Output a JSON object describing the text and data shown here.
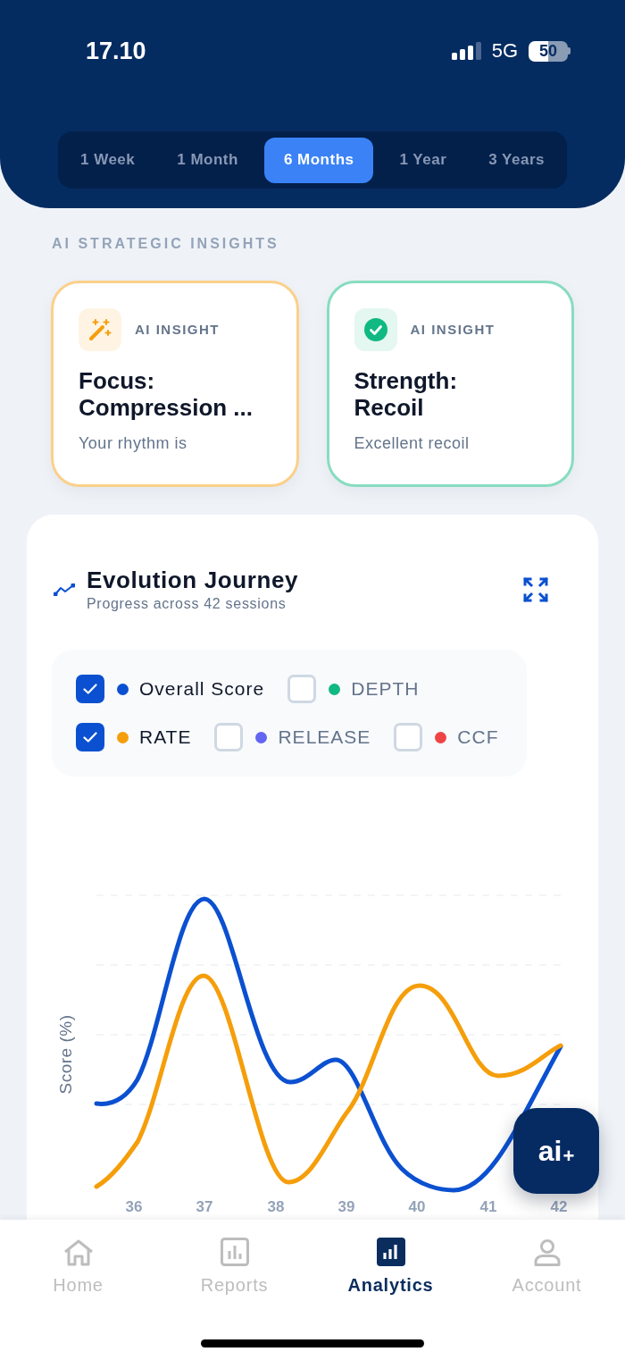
{
  "status_bar": {
    "time": "17.10",
    "network": "5G",
    "battery": "50"
  },
  "period_tabs": [
    {
      "label": "1 Week",
      "selected": false
    },
    {
      "label": "1 Month",
      "selected": false
    },
    {
      "label": "6 Months",
      "selected": true
    },
    {
      "label": "1 Year",
      "selected": false
    },
    {
      "label": "3 Years",
      "selected": false
    }
  ],
  "insights": {
    "heading": "AI STRATEGIC INSIGHTS",
    "cards": [
      {
        "kind": "focus",
        "tag": "AI INSIGHT",
        "title": "Focus:\nCompression ...",
        "text": "Your rhythm is"
      },
      {
        "kind": "strength",
        "tag": "AI INSIGHT",
        "title": "Strength:\nRecoil",
        "text": "Excellent recoil"
      }
    ]
  },
  "evolution": {
    "title": "Evolution Journey",
    "subtitle": "Progress across 42 sessions",
    "legend": [
      {
        "label": "Overall Score",
        "color": "#0b50d0",
        "checked": true
      },
      {
        "label": "DEPTH",
        "color": "#10b981",
        "checked": false
      },
      {
        "label": "RATE",
        "color": "#f59e0b",
        "checked": true
      },
      {
        "label": "RELEASE",
        "color": "#6366f1",
        "checked": false
      },
      {
        "label": "CCF",
        "color": "#ef4444",
        "checked": false
      }
    ],
    "chart": {
      "ylabel": "Score (%)",
      "x_labels": [
        "36",
        "37",
        "38",
        "39",
        "40",
        "41",
        "42"
      ]
    }
  },
  "fab": {
    "label": "ai$_{+}$"
  },
  "bottom_nav": [
    {
      "label": "Home",
      "selected": false
    },
    {
      "label": "Reports",
      "selected": false
    },
    {
      "label": "Analytics",
      "selected": true
    },
    {
      "label": "Account",
      "selected": false
    }
  ]
}
